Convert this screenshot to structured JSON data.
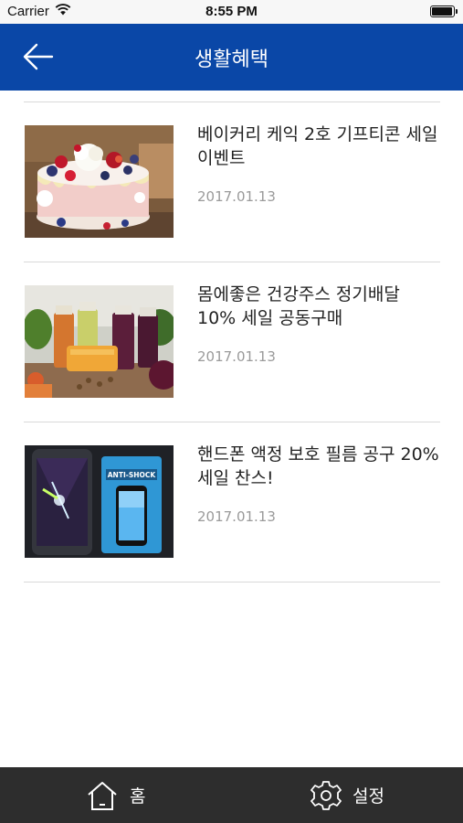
{
  "status_bar": {
    "carrier": "Carrier",
    "time": "8:55 PM",
    "battery_level": 1.0
  },
  "nav": {
    "title": "생활혜택",
    "back_icon": "arrow-left-icon",
    "background_color": "#0a47a7"
  },
  "items": [
    {
      "title": "베이커리 케익 2호 기프티콘 세일이벤트",
      "date": "2017.01.13",
      "image": "cake-photo"
    },
    {
      "title": "몸에좋은 건강주스 정기배달 10% 세일 공동구매",
      "date": "2017.01.13",
      "image": "juice-photo"
    },
    {
      "title": "핸드폰 액정 보호 필름 공구 20% 세일 찬스!",
      "date": "2017.01.13",
      "image": "screen-protector-photo",
      "image_text": "ANTI-SHOCK"
    }
  ],
  "tab_bar": {
    "home_label": "홈",
    "settings_label": "설정",
    "home_icon": "home-icon",
    "settings_icon": "gear-icon",
    "background_color": "#2d2d2d"
  }
}
